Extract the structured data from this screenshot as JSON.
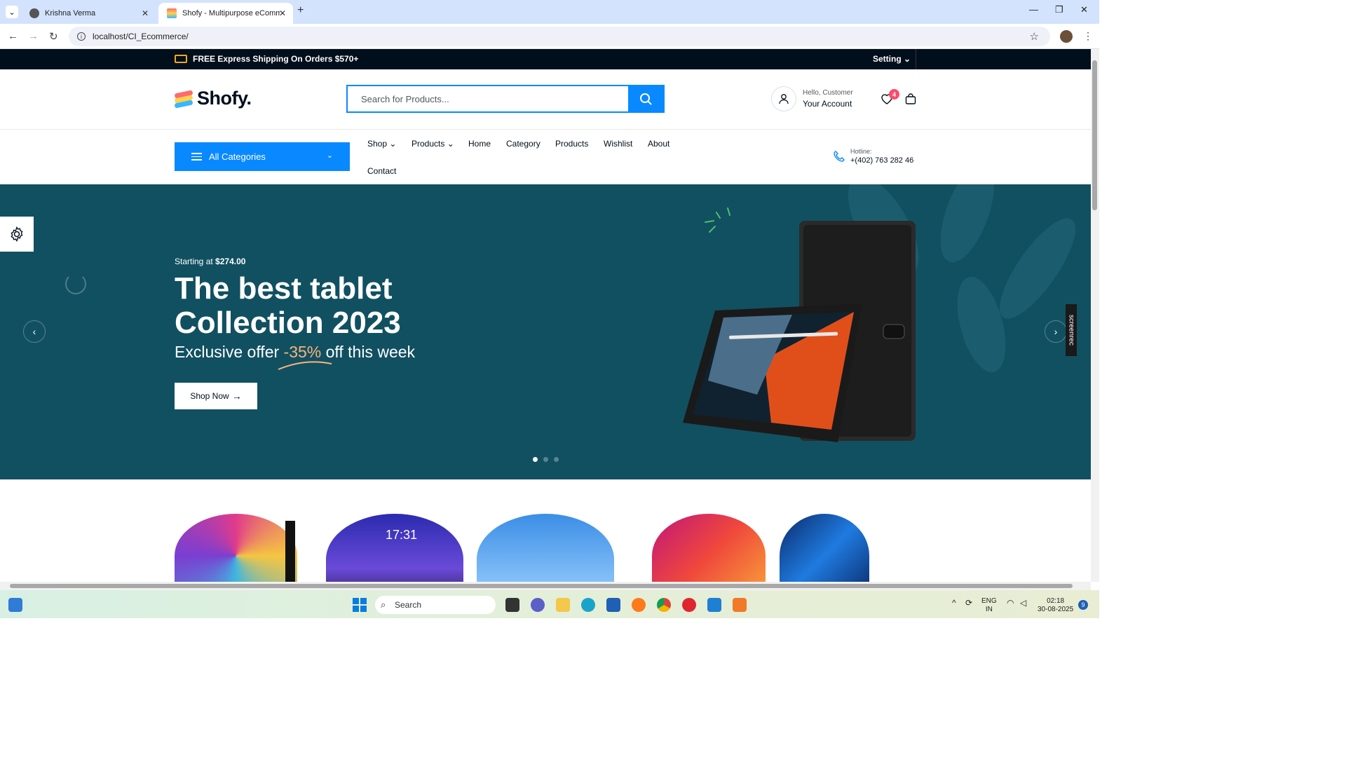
{
  "browser": {
    "tabs": [
      {
        "title": "Krishna Verma",
        "active": false
      },
      {
        "title": "Shofy - Multipurpose eCommer",
        "active": true
      }
    ],
    "url": "localhost/CI_Ecommerce/"
  },
  "topbar": {
    "shipping_text": "FREE Express Shipping On Orders $570+",
    "setting_label": "Setting"
  },
  "header": {
    "logo_text": "Shofy.",
    "search_placeholder": "Search for Products...",
    "account_hello": "Hello, Customer",
    "account_label": "Your Account",
    "wishlist_count": "4"
  },
  "nav": {
    "all_categories": "All Categories",
    "items": [
      "Shop",
      "Products",
      "Home",
      "Category",
      "Products",
      "Wishlist",
      "About",
      "Contact"
    ],
    "hotline_label": "Hotline:",
    "hotline_number": "+(402) 763 282 46"
  },
  "hero": {
    "starting_prefix": "Starting at",
    "starting_price": "$274.00",
    "title_line1": "The best tablet",
    "title_line2": "Collection 2023",
    "subtitle_prefix": "Exclusive offer",
    "subtitle_pct": "-35%",
    "subtitle_suffix": "off this week",
    "cta": "Shop Now",
    "slides": 3,
    "active_slide": 1,
    "overlay_label": "screenrec"
  },
  "taskbar": {
    "search_label": "Search",
    "lang_line1": "ENG",
    "lang_line2": "IN",
    "time": "02:18",
    "date": "30-08-2025",
    "notification_count": "9"
  },
  "colors": {
    "accent": "#0989ff",
    "hero_bg": "#115061",
    "topbar_bg": "#010f1c",
    "badge": "#fd4b6b"
  }
}
